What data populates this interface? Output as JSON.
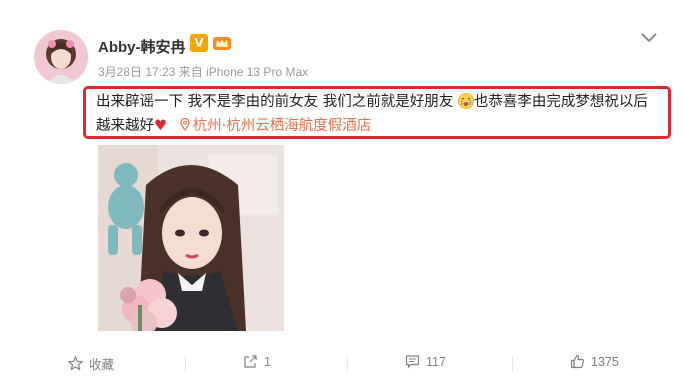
{
  "post": {
    "username": "Abby-韩安冉",
    "verified_badge": "V",
    "member_badge_icon": "crown-icon",
    "meta": "3月28日 17:23 来自 iPhone 13 Pro Max",
    "text_part1": "出来辟谣一下 我不是李由的前女友 我们之前就是好朋友",
    "text_part2": "也恭喜李由完成梦想祝以后越来越好",
    "heart": "♥",
    "location": "杭州·杭州云栖海航度假酒店",
    "highlight_color": "#e0262e",
    "location_color": "#eb7350"
  },
  "actions": {
    "favorite_label": "收藏",
    "repost_count": "1",
    "comment_count": "117",
    "like_count": "1375"
  }
}
